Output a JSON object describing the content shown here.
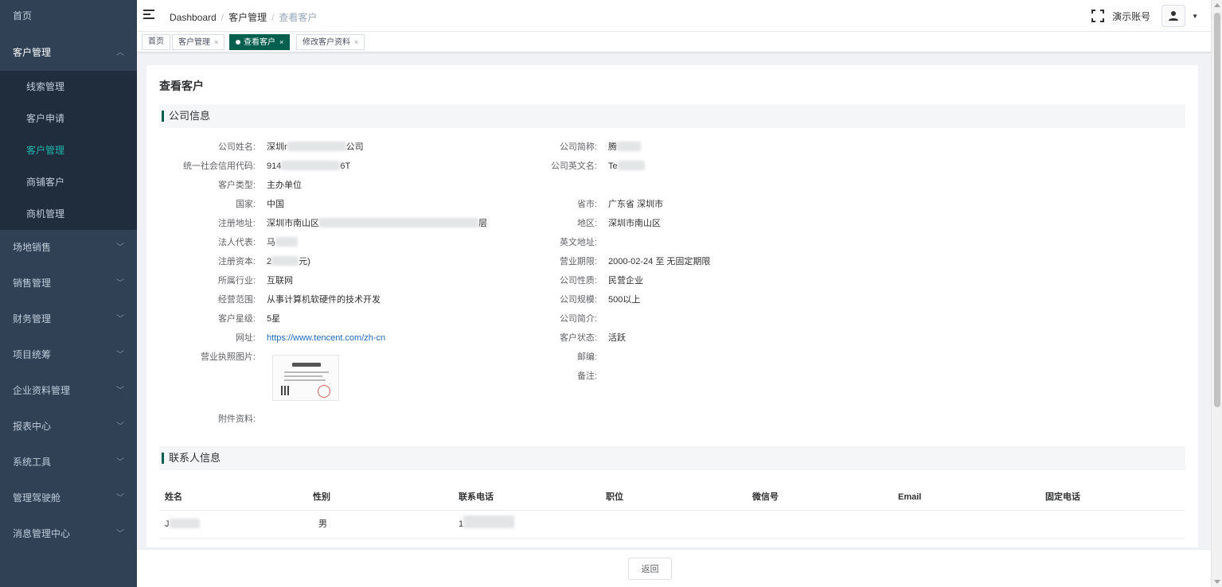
{
  "sidebar": {
    "items": [
      {
        "label": "首页"
      },
      {
        "label": "客户管理",
        "children": [
          {
            "label": "线索管理"
          },
          {
            "label": "客户申请"
          },
          {
            "label": "客户管理"
          },
          {
            "label": "商铺客户"
          },
          {
            "label": "商机管理"
          }
        ]
      },
      {
        "label": "场地销售"
      },
      {
        "label": "销售管理"
      },
      {
        "label": "财务管理"
      },
      {
        "label": "项目统筹"
      },
      {
        "label": "企业资料管理"
      },
      {
        "label": "报表中心"
      },
      {
        "label": "系统工具"
      },
      {
        "label": "管理驾驶舱"
      },
      {
        "label": "消息管理中心"
      }
    ],
    "colors": {
      "bg": "#304156",
      "submenu_bg": "#1f2d3d",
      "active": "#20b2aa"
    }
  },
  "navbar": {
    "breadcrumb": [
      "Dashboard",
      "客户管理",
      "查看客户"
    ],
    "account_name": "演示账号"
  },
  "tags": [
    {
      "label": "首页"
    },
    {
      "label": "客户管理"
    },
    {
      "label": "查看客户"
    },
    {
      "label": "修改客户资料"
    }
  ],
  "page": {
    "title": "查看客户",
    "company_section": "公司信息",
    "contact_section": "联系人信息",
    "accent_color": "#035f4e"
  },
  "company": {
    "left": [
      {
        "label": "公司姓名:",
        "value_prefix": "深圳r",
        "value_suffix": "公司"
      },
      {
        "label": "统一社会信用代码:",
        "value_prefix": "914",
        "value_suffix": "6T"
      },
      {
        "label": "客户类型:",
        "value": "主办单位"
      },
      {
        "label": "国家:",
        "value": "中国"
      },
      {
        "label": "注册地址:",
        "value_prefix": "深圳市南山区",
        "value_suffix": "层"
      },
      {
        "label": "法人代表:",
        "value_prefix": "马"
      },
      {
        "label": "注册资本:",
        "value_prefix": "2",
        "value_suffix": "元)"
      },
      {
        "label": "所属行业:",
        "value": "互联网"
      },
      {
        "label": "经营范围:",
        "value": "从事计算机软硬件的技术开发"
      },
      {
        "label": "客户星级:",
        "value": "5星"
      },
      {
        "label": "网址:",
        "value": "https://www.tencent.com/zh-cn"
      },
      {
        "label": "营业执照图片:"
      },
      {
        "label": "附件资料:"
      }
    ],
    "right": [
      {
        "label": "公司简称:",
        "value_prefix": "腾"
      },
      {
        "label": "公司英文名:",
        "value_prefix": "Te"
      },
      {
        "label": "省市:",
        "value": "广东省 深圳市"
      },
      {
        "label": "地区:",
        "value": "深圳市南山区"
      },
      {
        "label": "英文地址:",
        "value": ""
      },
      {
        "label": "营业期限:",
        "value": "2000-02-24 至 无固定期限"
      },
      {
        "label": "公司性质:",
        "value": "民营企业"
      },
      {
        "label": "公司规模:",
        "value": "500以上"
      },
      {
        "label": "公司简介:",
        "value": ""
      },
      {
        "label": "客户状态:",
        "value": "活跃"
      },
      {
        "label": "邮编:",
        "value": ""
      },
      {
        "label": "备注:",
        "value": ""
      }
    ]
  },
  "contacts": {
    "columns": [
      "姓名",
      "性别",
      "联系电话",
      "职位",
      "微信号",
      "Email",
      "固定电话"
    ],
    "rows": [
      {
        "name_prefix": "J",
        "gender": "男",
        "phone_prefix": "1"
      }
    ]
  },
  "footer": {
    "back_label": "返回"
  }
}
